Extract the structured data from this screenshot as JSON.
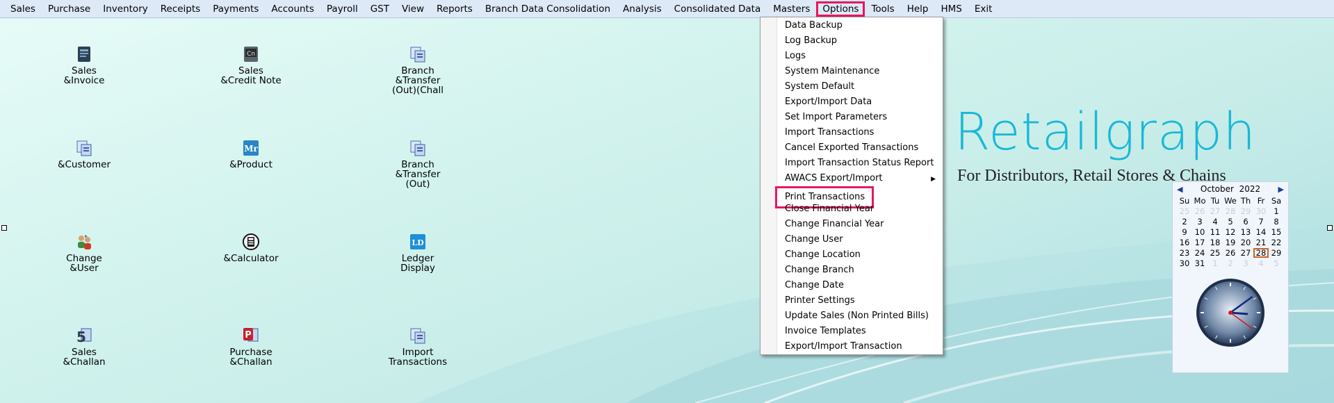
{
  "menubar": {
    "items": [
      "Sales",
      "Purchase",
      "Inventory",
      "Receipts",
      "Payments",
      "Accounts",
      "Payroll",
      "GST",
      "View",
      "Reports",
      "Branch Data Consolidation",
      "Analysis",
      "Consolidated Data",
      "Masters",
      "Options",
      "Tools",
      "Help",
      "HMS",
      "Exit"
    ],
    "active": "Options"
  },
  "shortcuts": [
    {
      "label": "Sales\n&Invoice",
      "icon": "sales-invoice-icon"
    },
    {
      "label": "Sales\n&Credit Note",
      "icon": "credit-note-icon"
    },
    {
      "label": "Branch\n&Transfer\n(Out)(Chall",
      "icon": "branch-transfer-icon"
    },
    {
      "label": "&Customer",
      "icon": "customer-icon"
    },
    {
      "label": "&Product",
      "icon": "product-icon"
    },
    {
      "label": "Branch\n&Transfer\n(Out)",
      "icon": "branch-transfer-out-icon"
    },
    {
      "label": "Change\n&User",
      "icon": "change-user-icon"
    },
    {
      "label": "&Calculator",
      "icon": "calculator-icon"
    },
    {
      "label": "Ledger\nDisplay",
      "icon": "ledger-icon"
    },
    {
      "label": "Sales\n&Challan",
      "icon": "sales-challan-icon"
    },
    {
      "label": "Purchase\n&Challan",
      "icon": "purchase-challan-icon"
    },
    {
      "label": "Import\nTransactions",
      "icon": "import-transactions-icon"
    }
  ],
  "logo": {
    "name": "Retailgraph",
    "tagline": "For Distributors, Retail Stores & Chains"
  },
  "calendar": {
    "month": "October",
    "year": "2022",
    "weekdays": [
      "Su",
      "Mo",
      "Tu",
      "We",
      "Th",
      "Fr",
      "Sa"
    ],
    "days": [
      {
        "d": "25",
        "dim": true
      },
      {
        "d": "26",
        "dim": true
      },
      {
        "d": "27",
        "dim": true
      },
      {
        "d": "28",
        "dim": true
      },
      {
        "d": "29",
        "dim": true
      },
      {
        "d": "30",
        "dim": true
      },
      {
        "d": "1"
      },
      {
        "d": "2"
      },
      {
        "d": "3"
      },
      {
        "d": "4"
      },
      {
        "d": "5"
      },
      {
        "d": "6"
      },
      {
        "d": "7"
      },
      {
        "d": "8"
      },
      {
        "d": "9"
      },
      {
        "d": "10"
      },
      {
        "d": "11"
      },
      {
        "d": "12"
      },
      {
        "d": "13"
      },
      {
        "d": "14"
      },
      {
        "d": "15"
      },
      {
        "d": "16"
      },
      {
        "d": "17"
      },
      {
        "d": "18"
      },
      {
        "d": "19"
      },
      {
        "d": "20"
      },
      {
        "d": "21"
      },
      {
        "d": "22"
      },
      {
        "d": "23"
      },
      {
        "d": "24"
      },
      {
        "d": "25"
      },
      {
        "d": "26"
      },
      {
        "d": "27"
      },
      {
        "d": "28",
        "today": true
      },
      {
        "d": "29"
      },
      {
        "d": "30"
      },
      {
        "d": "31"
      },
      {
        "d": "1",
        "dim": true
      },
      {
        "d": "2",
        "dim": true
      },
      {
        "d": "3",
        "dim": true
      },
      {
        "d": "4",
        "dim": true
      },
      {
        "d": "5",
        "dim": true
      }
    ],
    "clock": {
      "hour": 3,
      "minute": 9,
      "second": 21
    }
  },
  "options_menu": {
    "items": [
      {
        "label": "Data Backup"
      },
      {
        "label": "Log Backup"
      },
      {
        "label": "Logs"
      },
      {
        "label": "System Maintenance"
      },
      {
        "label": "System Default"
      },
      {
        "label": "Export/Import Data"
      },
      {
        "label": "Set Import Parameters"
      },
      {
        "label": "Import Transactions"
      },
      {
        "label": "Cancel Exported Transactions"
      },
      {
        "label": "Import Transaction Status Report"
      },
      {
        "label": "AWACS Export/Import",
        "submenu": true
      },
      {
        "label": "Print Transactions",
        "highlighted": true
      },
      {
        "label": "Close Financial Year"
      },
      {
        "label": "Change Financial Year"
      },
      {
        "label": "Change User"
      },
      {
        "label": "Change Location"
      },
      {
        "label": "Change Branch"
      },
      {
        "label": "Change Date"
      },
      {
        "label": "Printer Settings"
      },
      {
        "label": "Update Sales (Non Printed Bills)"
      },
      {
        "label": "Invoice Templates"
      },
      {
        "label": "Export/Import Transaction"
      }
    ]
  },
  "colors": {
    "highlight_border": "#e8175d",
    "logo_blue": "#1bb8d6",
    "menubar_bg": "#dde9f7"
  }
}
